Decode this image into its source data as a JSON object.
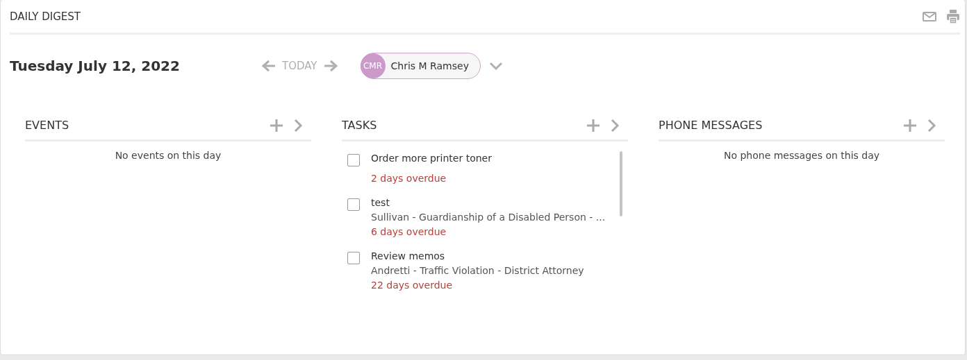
{
  "title": "DAILY DIGEST",
  "date": "Tuesday July 12, 2022",
  "nav": {
    "today": "TODAY"
  },
  "user": {
    "initials": "CMR",
    "name": "Chris M Ramsey"
  },
  "panels": [
    {
      "title": "EVENTS",
      "empty_text": "No events on this day"
    },
    {
      "title": "TASKS",
      "items": [
        {
          "title": "Order more printer toner",
          "checked": false,
          "due": "2 days overdue"
        },
        {
          "title": "test",
          "checked": false,
          "matter": "Sullivan - Guardianship of a Disabled Person - ...",
          "due": "6 days overdue"
        },
        {
          "title": "Review memos",
          "checked": false,
          "matter": "Andretti - Traffic Violation - District Attorney",
          "due": "22 days overdue"
        }
      ]
    },
    {
      "title": "PHONE MESSAGES",
      "empty_text": "No phone messages on this day"
    }
  ]
}
